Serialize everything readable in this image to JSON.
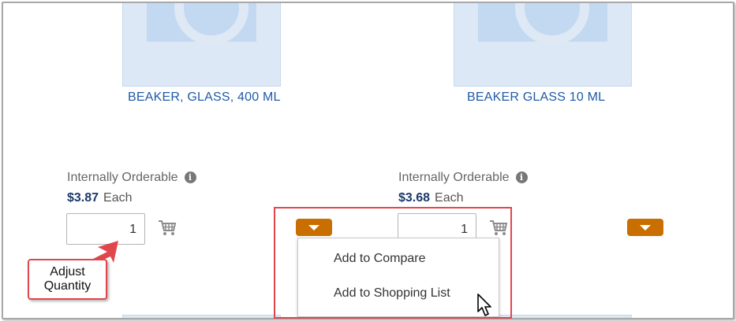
{
  "products": [
    {
      "name": "BEAKER, GLASS, 400 ML",
      "availability": "Internally Orderable",
      "price": "$3.87",
      "unit": "Each",
      "quantity": "1"
    },
    {
      "name": "BEAKER GLASS 10 ML",
      "availability": "Internally Orderable",
      "price": "$3.68",
      "unit": "Each",
      "quantity": "1"
    }
  ],
  "menu": {
    "items": [
      "Add to Compare",
      "Add to Shopping List"
    ]
  },
  "callout": {
    "line1": "Adjust",
    "line2": "Quantity"
  },
  "icons": {
    "info": "info-icon",
    "cart": "cart-icon",
    "dropdown": "caret-down-icon",
    "cursor": "mouse-pointer-icon"
  },
  "colors": {
    "link": "#1f5aa8",
    "price": "#1a3a6b",
    "dropdown": "#c96e00",
    "annotation": "#e0474c"
  }
}
